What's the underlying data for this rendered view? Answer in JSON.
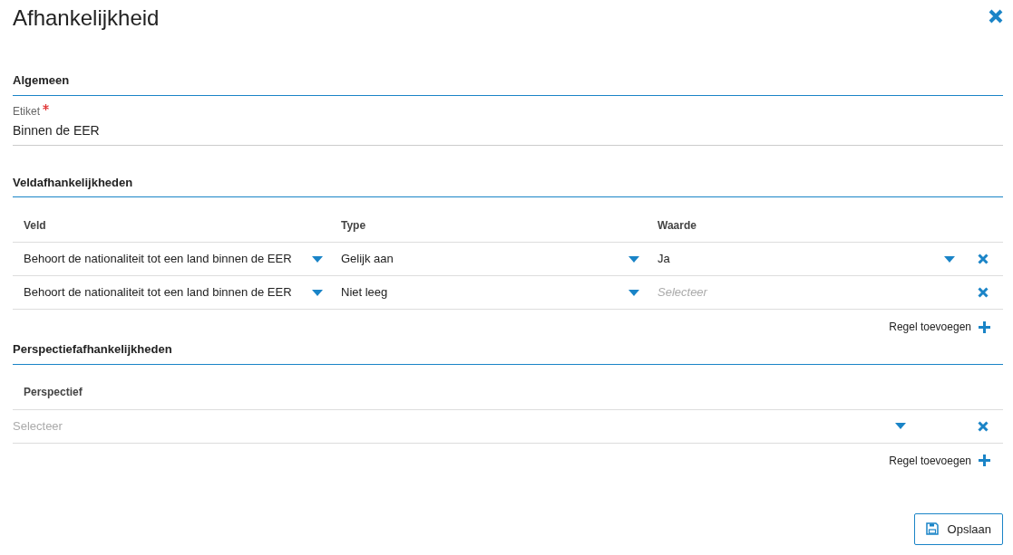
{
  "title": "Afhankelijkheid",
  "general": {
    "heading": "Algemeen",
    "label": "Etiket",
    "required": true,
    "value": "Binnen de EER"
  },
  "field_dependencies": {
    "heading": "Veldafhankelijkheden",
    "columns": [
      "Veld",
      "Type",
      "Waarde"
    ],
    "rows": [
      {
        "field": "Behoort de nationaliteit tot een land binnen de EER",
        "type": "Gelijk aan",
        "value": "Ja"
      },
      {
        "field": "Behoort de nationaliteit tot een land binnen de EER",
        "type": "Niet leeg",
        "placeholder": "Selecteer"
      }
    ],
    "add_label": "Regel toevoegen"
  },
  "perspective_dependencies": {
    "heading": "Perspectiefafhankelijkheden",
    "columns": [
      "Perspectief"
    ],
    "rows": [
      {
        "placeholder": "Selecteer"
      }
    ],
    "add_label": "Regel toevoegen"
  },
  "save_button": "Opslaan"
}
